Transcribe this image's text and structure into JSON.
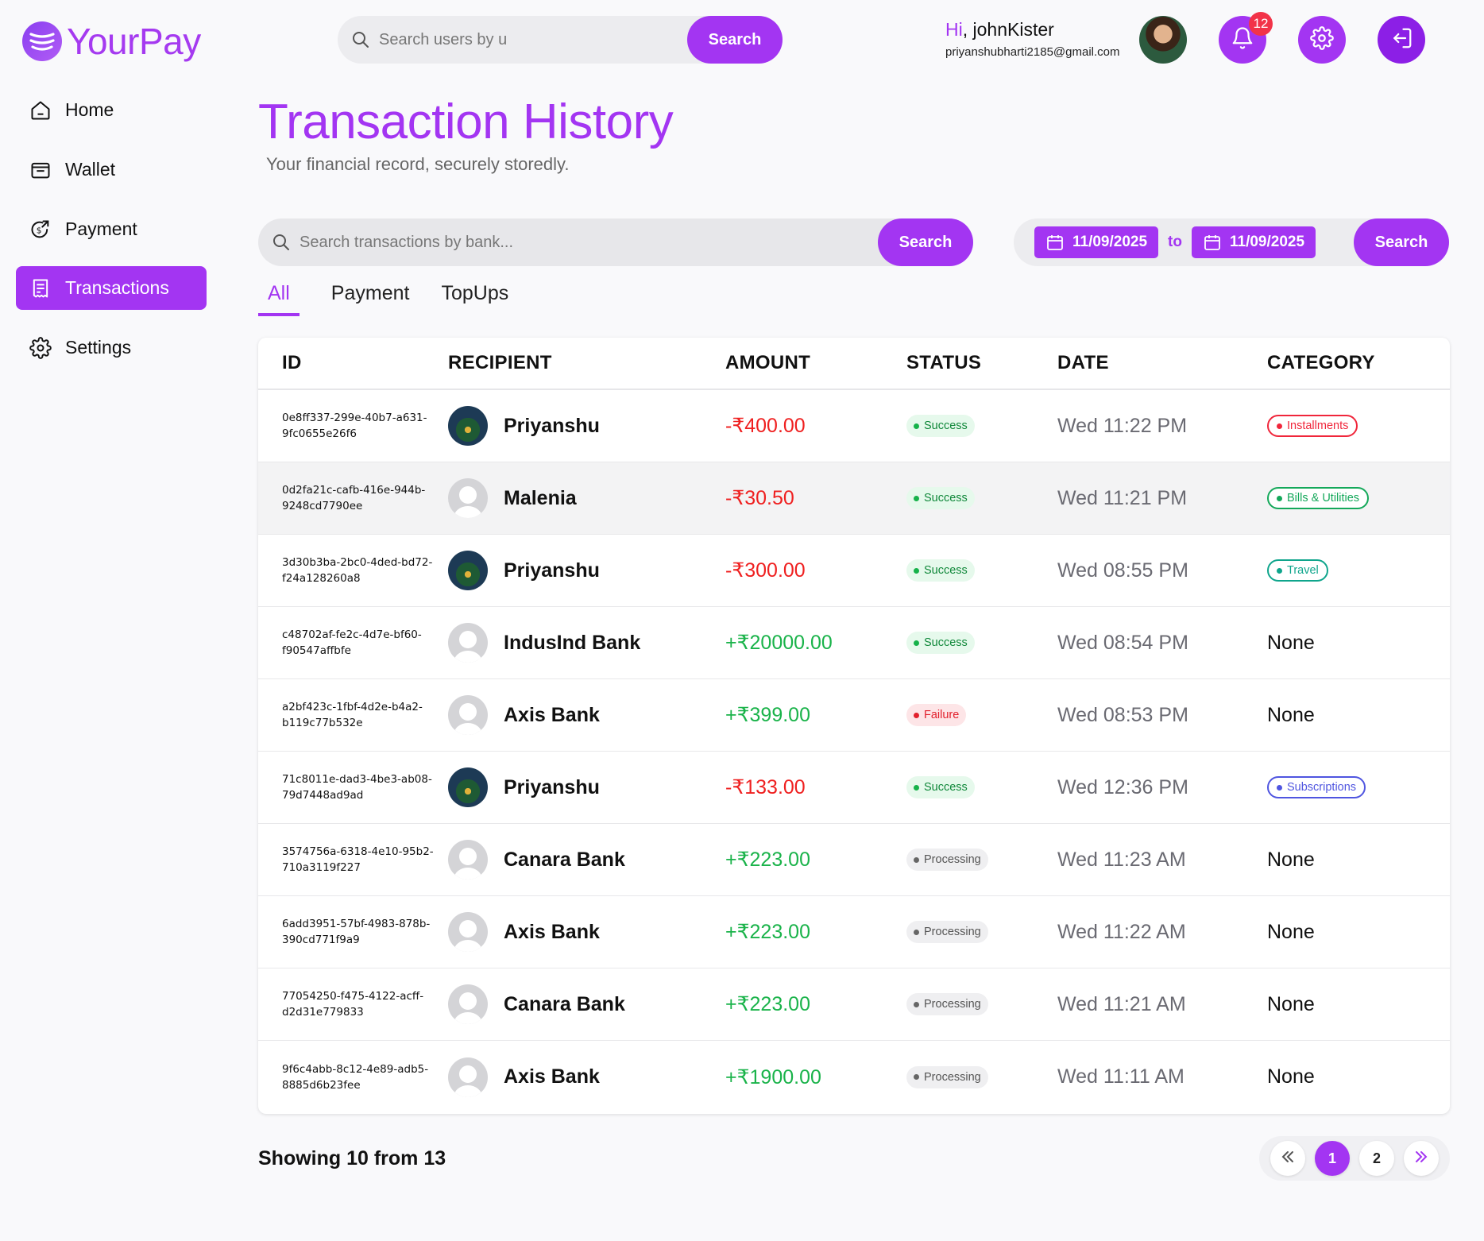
{
  "brand": {
    "name": "YourPay"
  },
  "topbar": {
    "search_placeholder": "Search users by u",
    "search_button": "Search",
    "greeting_prefix": "Hi",
    "username": "johnKister",
    "email": "priyanshubharti2185@gmail.com",
    "notification_count": "12"
  },
  "sidebar": {
    "items": [
      {
        "label": "Home",
        "icon": "home-icon"
      },
      {
        "label": "Wallet",
        "icon": "wallet-icon"
      },
      {
        "label": "Payment",
        "icon": "payment-icon"
      },
      {
        "label": "Transactions",
        "icon": "receipt-icon",
        "active": true
      },
      {
        "label": "Settings",
        "icon": "gear-icon"
      }
    ]
  },
  "page": {
    "title": "Transaction History",
    "subtitle": "Your financial record, securely storedly."
  },
  "filters": {
    "search_placeholder": "Search transactions by bank...",
    "search_button": "Search",
    "date_from": "11/09/2025",
    "date_to_label": "to",
    "date_to": "11/09/2025",
    "date_search_button": "Search"
  },
  "tabs": [
    "All",
    "Payment",
    "TopUps"
  ],
  "table": {
    "headers": [
      "ID",
      "RECIPIENT",
      "AMOUNT",
      "STATUS",
      "DATE",
      "CATEGORY"
    ],
    "rows": [
      {
        "id": "0e8ff337-299e-40b7-a631-9fc0655e26f6",
        "recipient": "Priyanshu",
        "avatar": "photo",
        "amount": "-₹400.00",
        "direction": "out",
        "status": "Success",
        "date": "Wed 11:22 PM",
        "category": "Installments",
        "category_color": "#f0263b"
      },
      {
        "id": "0d2fa21c-cafb-416e-944b-9248cd7790ee",
        "recipient": "Malenia",
        "avatar": "default",
        "amount": "-₹30.50",
        "direction": "out",
        "status": "Success",
        "date": "Wed 11:21 PM",
        "category": "Bills & Utilities",
        "category_color": "#14a85a"
      },
      {
        "id": "3d30b3ba-2bc0-4ded-bd72-f24a128260a8",
        "recipient": "Priyanshu",
        "avatar": "photo",
        "amount": "-₹300.00",
        "direction": "out",
        "status": "Success",
        "date": "Wed 08:55 PM",
        "category": "Travel",
        "category_color": "#0fa58c"
      },
      {
        "id": "c48702af-fe2c-4d7e-bf60-f90547affbfe",
        "recipient": "IndusInd Bank",
        "avatar": "default",
        "amount": "+₹20000.00",
        "direction": "in",
        "status": "Success",
        "date": "Wed 08:54 PM",
        "category": "None",
        "category_color": ""
      },
      {
        "id": "a2bf423c-1fbf-4d2e-b4a2-b119c77b532e",
        "recipient": "Axis Bank",
        "avatar": "default",
        "amount": "+₹399.00",
        "direction": "in",
        "status": "Failure",
        "date": "Wed 08:53 PM",
        "category": "None",
        "category_color": ""
      },
      {
        "id": "71c8011e-dad3-4be3-ab08-79d7448ad9ad",
        "recipient": "Priyanshu",
        "avatar": "photo",
        "amount": "-₹133.00",
        "direction": "out",
        "status": "Success",
        "date": "Wed 12:36 PM",
        "category": "Subscriptions",
        "category_color": "#4f55e0"
      },
      {
        "id": "3574756a-6318-4e10-95b2-710a3119f227",
        "recipient": "Canara Bank",
        "avatar": "default",
        "amount": "+₹223.00",
        "direction": "in",
        "status": "Processing",
        "date": "Wed 11:23 AM",
        "category": "None",
        "category_color": ""
      },
      {
        "id": "6add3951-57bf-4983-878b-390cd771f9a9",
        "recipient": "Axis Bank",
        "avatar": "default",
        "amount": "+₹223.00",
        "direction": "in",
        "status": "Processing",
        "date": "Wed 11:22 AM",
        "category": "None",
        "category_color": ""
      },
      {
        "id": "77054250-f475-4122-acff-d2d31e779833",
        "recipient": "Canara Bank",
        "avatar": "default",
        "amount": "+₹223.00",
        "direction": "in",
        "status": "Processing",
        "date": "Wed 11:21 AM",
        "category": "None",
        "category_color": ""
      },
      {
        "id": "9f6c4abb-8c12-4e89-adb5-8885d6b23fee",
        "recipient": "Axis Bank",
        "avatar": "default",
        "amount": "+₹1900.00",
        "direction": "in",
        "status": "Processing",
        "date": "Wed 11:11 AM",
        "category": "None",
        "category_color": ""
      }
    ]
  },
  "footer": {
    "showing_text": "Showing 10 from 13",
    "pages": [
      "1",
      "2"
    ],
    "current_page": "1"
  },
  "colors": {
    "accent": "#a335f2",
    "negative": "#ef2020",
    "positive": "#1ab34a"
  }
}
